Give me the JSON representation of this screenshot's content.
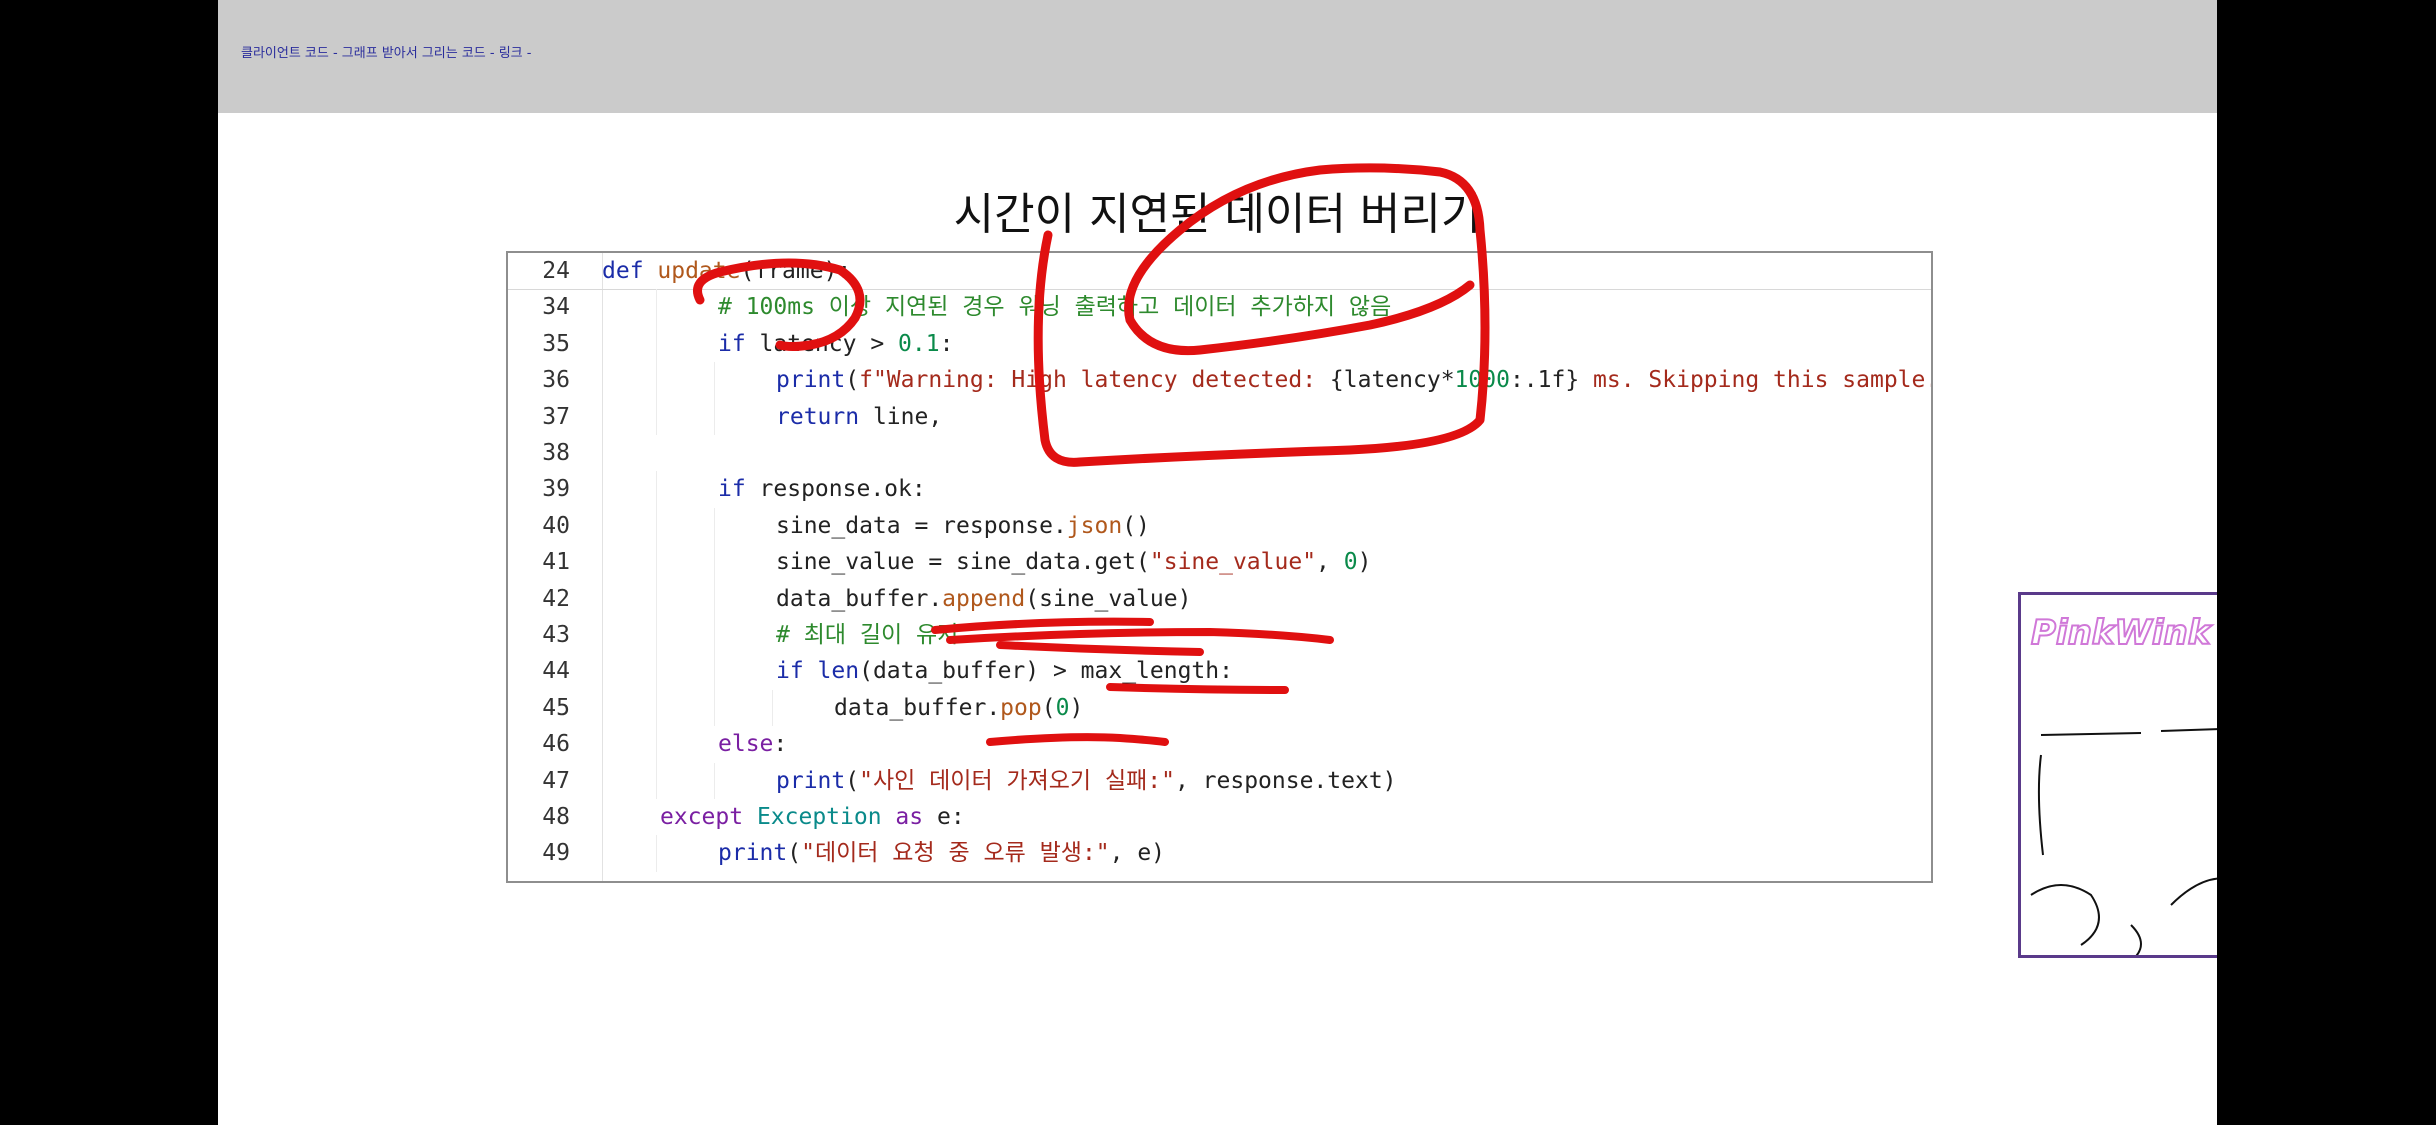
{
  "topbar": {
    "breadcrumb": "클라이언트 코드 - 그래프 받아서 그리는 코드 - 링크 -"
  },
  "slide": {
    "title": "시간이 지연된 데이터 버리기"
  },
  "code": {
    "lines": [
      {
        "num": "24",
        "indent": 0,
        "tokens": [
          [
            "kw",
            "def "
          ],
          [
            "fn",
            "update"
          ],
          [
            "id",
            "(frame):"
          ]
        ]
      },
      {
        "num": "34",
        "indent": 2,
        "tokens": [
          [
            "cm",
            "# 100ms 이상 지연된 경우 워닝 출력하고 데이터 추가하지 않음"
          ]
        ]
      },
      {
        "num": "35",
        "indent": 2,
        "tokens": [
          [
            "kw",
            "if "
          ],
          [
            "id",
            "latency > "
          ],
          [
            "num",
            "0.1"
          ],
          [
            "id",
            ":"
          ]
        ]
      },
      {
        "num": "36",
        "indent": 3,
        "tokens": [
          [
            "kw",
            "print"
          ],
          [
            "id",
            "("
          ],
          [
            "str",
            "f\"Warning: High latency detected: "
          ],
          [
            "id",
            "{latency*"
          ],
          [
            "num",
            "1000"
          ],
          [
            "id",
            ":.1f}"
          ],
          [
            "str",
            " ms. Skipping this sample.\""
          ],
          [
            "id",
            ")"
          ]
        ]
      },
      {
        "num": "37",
        "indent": 3,
        "tokens": [
          [
            "kw",
            "return "
          ],
          [
            "id",
            "line,"
          ]
        ]
      },
      {
        "num": "38",
        "indent": 0,
        "tokens": []
      },
      {
        "num": "39",
        "indent": 2,
        "tokens": [
          [
            "kw",
            "if "
          ],
          [
            "id",
            "response.ok:"
          ]
        ]
      },
      {
        "num": "40",
        "indent": 3,
        "tokens": [
          [
            "id",
            "sine_data = response."
          ],
          [
            "fn",
            "json"
          ],
          [
            "id",
            "()"
          ]
        ]
      },
      {
        "num": "41",
        "indent": 3,
        "tokens": [
          [
            "id",
            "sine_value = sine_data.get("
          ],
          [
            "str",
            "\"sine_value\""
          ],
          [
            "id",
            ", "
          ],
          [
            "num",
            "0"
          ],
          [
            "id",
            ")"
          ]
        ]
      },
      {
        "num": "42",
        "indent": 3,
        "tokens": [
          [
            "id",
            "data_buffer."
          ],
          [
            "fn",
            "append"
          ],
          [
            "id",
            "(sine_value)"
          ]
        ]
      },
      {
        "num": "43",
        "indent": 3,
        "tokens": [
          [
            "cm",
            "# 최대 길이 유지"
          ]
        ]
      },
      {
        "num": "44",
        "indent": 3,
        "tokens": [
          [
            "kw",
            "if "
          ],
          [
            "kw",
            "len"
          ],
          [
            "id",
            "(data_buffer) > max_length:"
          ]
        ]
      },
      {
        "num": "45",
        "indent": 4,
        "tokens": [
          [
            "id",
            "data_buffer."
          ],
          [
            "fn",
            "pop"
          ],
          [
            "id",
            "("
          ],
          [
            "num",
            "0"
          ],
          [
            "id",
            ")"
          ]
        ]
      },
      {
        "num": "46",
        "indent": 2,
        "tokens": [
          [
            "kw2",
            "else"
          ],
          [
            "id",
            ":"
          ]
        ]
      },
      {
        "num": "47",
        "indent": 3,
        "tokens": [
          [
            "kw",
            "print"
          ],
          [
            "id",
            "("
          ],
          [
            "str",
            "\"사인 데이터 가져오기 실패:\""
          ],
          [
            "id",
            ", response.text)"
          ]
        ]
      },
      {
        "num": "48",
        "indent": 1,
        "tokens": [
          [
            "kw2",
            "except "
          ],
          [
            "cls",
            "Exception "
          ],
          [
            "kw2",
            "as "
          ],
          [
            "id",
            "e:"
          ]
        ]
      },
      {
        "num": "49",
        "indent": 2,
        "tokens": [
          [
            "kw",
            "print"
          ],
          [
            "id",
            "("
          ],
          [
            "str",
            "\"데이터 요청 중 오류 발생:\""
          ],
          [
            "id",
            ", e)"
          ]
        ]
      }
    ]
  },
  "webcam": {
    "watermark": "PinkWink @  PinkLAB"
  },
  "colors": {
    "annotation": "#e01010",
    "topbar": "#cbcbcb",
    "keyword": "#1b2ca8"
  }
}
